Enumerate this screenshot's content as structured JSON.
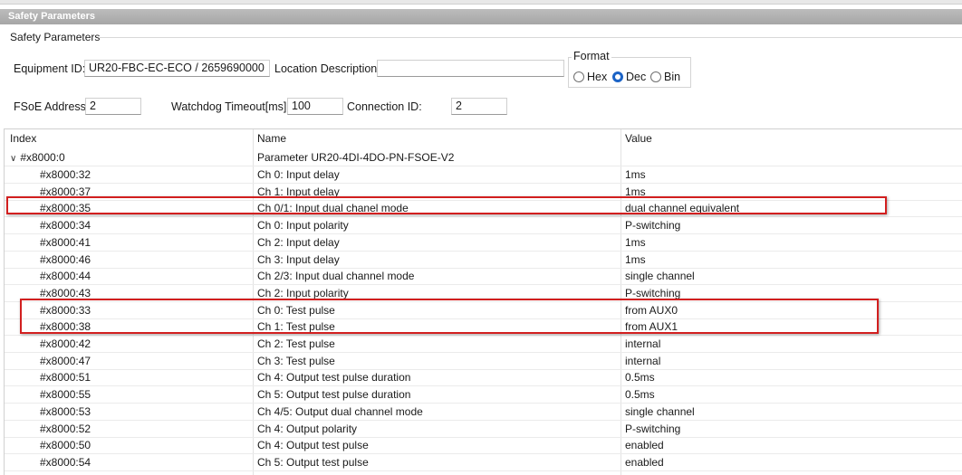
{
  "titlebar": "Safety Parameters",
  "group_label": "Safety Parameters",
  "equipment": {
    "label": "Equipment ID:",
    "value": "UR20-FBC-EC-ECO / 2659690000"
  },
  "location": {
    "label": "Location Description:",
    "value": ""
  },
  "format": {
    "legend": "Format",
    "options": [
      "Hex",
      "Dec",
      "Bin"
    ],
    "selected": "Dec"
  },
  "fsoe": {
    "label": "FSoE Address:",
    "value": "2"
  },
  "watchdog": {
    "label": "Watchdog Timeout[ms]:",
    "value": "100"
  },
  "connection": {
    "label": "Connection ID:",
    "value": "2"
  },
  "table": {
    "headers": [
      "Index",
      "Name",
      "Value"
    ],
    "parent": {
      "index": "#x8000:0",
      "name": "Parameter UR20-4DI-4DO-PN-FSOE-V2",
      "value": ""
    },
    "rows": [
      [
        "#x8000:32",
        "Ch 0: Input delay",
        "1ms"
      ],
      [
        "#x8000:37",
        "Ch 1: Input delay",
        "1ms"
      ],
      [
        "#x8000:35",
        "Ch 0/1: Input dual chanel mode",
        "dual channel equivalent"
      ],
      [
        "#x8000:34",
        "Ch 0: Input polarity",
        "P-switching"
      ],
      [
        "#x8000:41",
        "Ch 2: Input delay",
        "1ms"
      ],
      [
        "#x8000:46",
        "Ch 3: Input delay",
        "1ms"
      ],
      [
        "#x8000:44",
        "Ch 2/3: Input dual channel mode",
        "single channel"
      ],
      [
        "#x8000:43",
        "Ch 2: Input polarity",
        "P-switching"
      ],
      [
        "#x8000:33",
        "Ch 0: Test pulse",
        "from AUX0"
      ],
      [
        "#x8000:38",
        "Ch 1: Test pulse",
        "from AUX1"
      ],
      [
        "#x8000:42",
        "Ch 2: Test pulse",
        "internal"
      ],
      [
        "#x8000:47",
        "Ch 3: Test pulse",
        "internal"
      ],
      [
        "#x8000:51",
        "Ch 4: Output test pulse duration",
        "0.5ms"
      ],
      [
        "#x8000:55",
        "Ch 5: Output test pulse duration",
        "0.5ms"
      ],
      [
        "#x8000:53",
        "Ch 4/5: Output dual channel mode",
        "single channel"
      ],
      [
        "#x8000:52",
        "Ch 4: Output polarity",
        "P-switching"
      ],
      [
        "#x8000:50",
        "Ch 4: Output test pulse",
        "enabled"
      ],
      [
        "#x8000:54",
        "Ch 5: Output test pulse",
        "enabled"
      ]
    ]
  },
  "colors": {
    "highlight": "#d21f1f",
    "radio_selected": "#1b63c6",
    "titlebar": "#b0b0b0"
  },
  "icons": {
    "expand": "chevron-down-icon"
  }
}
